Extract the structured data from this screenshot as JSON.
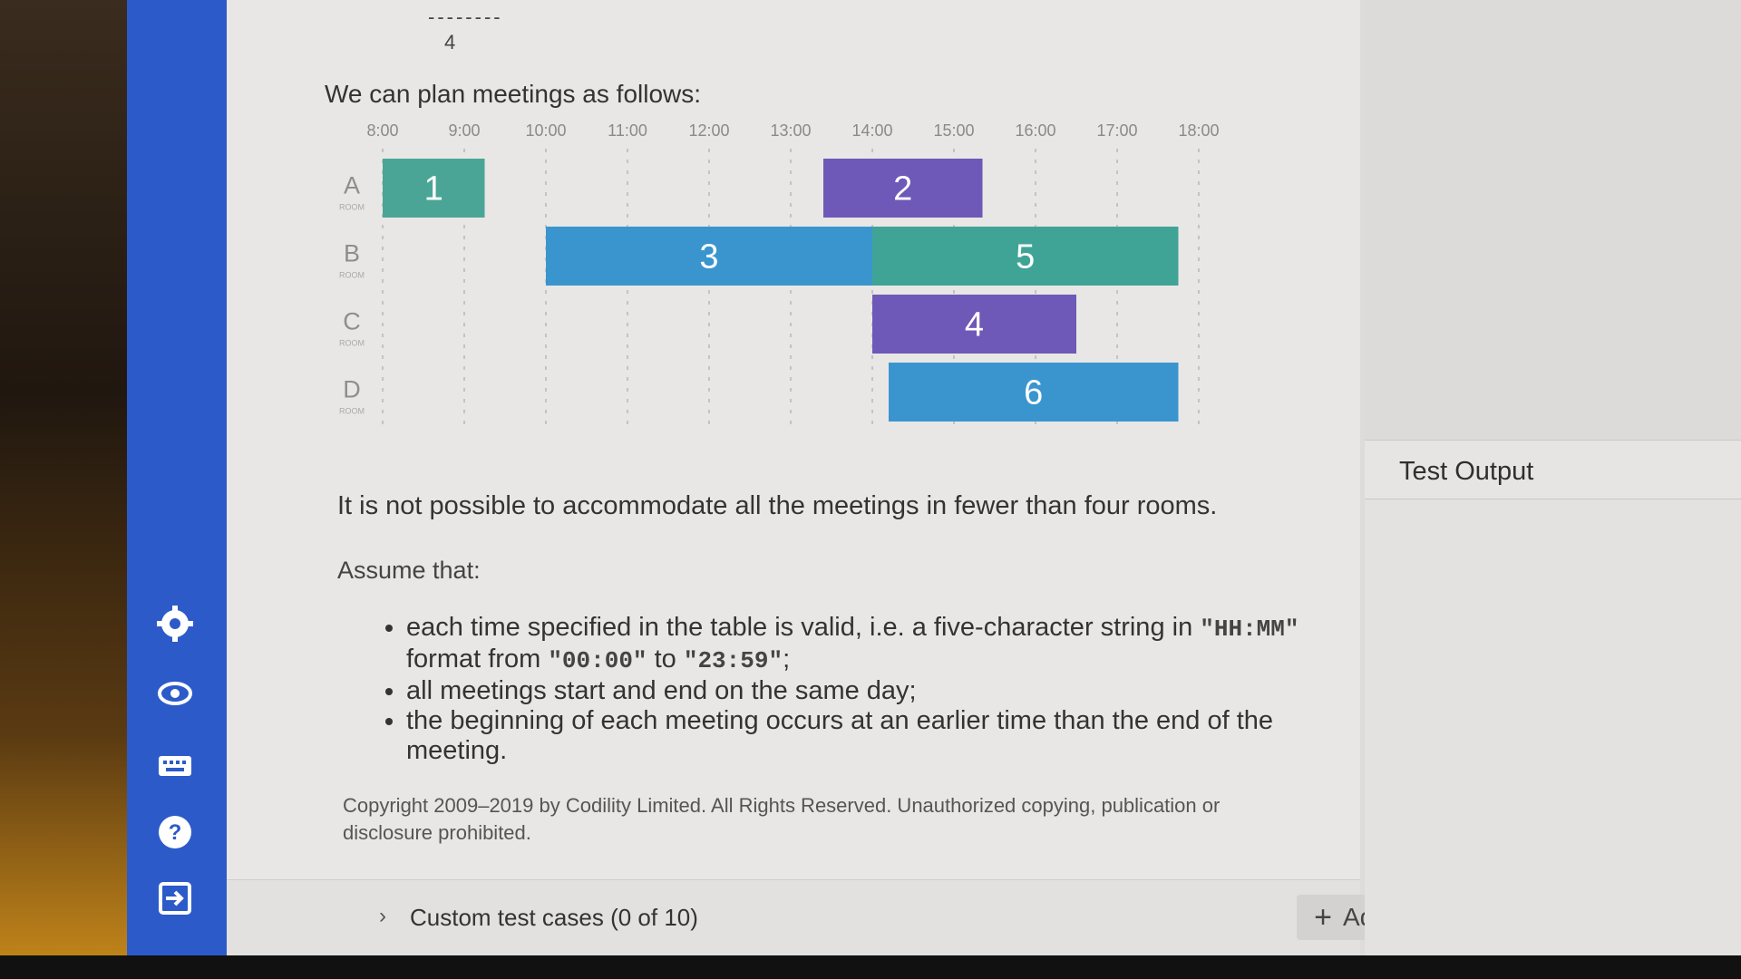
{
  "problem": {
    "previous_output_dashes": "--------",
    "previous_output_value": "4",
    "intro": "We can plan meetings as follows:",
    "conclusion": "It is not possible to accommodate all the meetings in fewer than four rooms.",
    "assume_heading": "Assume that:",
    "conditions": [
      {
        "before": "each time specified in the table is valid, i.e. a five-character string in ",
        "code1": "\"HH:MM\"",
        "mid1": " format from ",
        "code2": "\"00:00\"",
        "mid2": " to ",
        "code3": "\"23:59\"",
        "after": ";"
      },
      {
        "text": "all meetings start and end on the same day;"
      },
      {
        "text": "the beginning of each meeting occurs at an earlier time than the end of the meeting."
      }
    ],
    "copyright": "Copyright 2009–2019 by Codility Limited. All Rights Reserved. Unauthorized copying, publication or disclosure prohibited."
  },
  "chart_data": {
    "type": "timeline",
    "time_labels": [
      "8:00",
      "9:00",
      "10:00",
      "11:00",
      "12:00",
      "13:00",
      "14:00",
      "15:00",
      "16:00",
      "17:00",
      "18:00"
    ],
    "rooms": [
      {
        "name": "A",
        "sub": "ROOM"
      },
      {
        "name": "B",
        "sub": "ROOM"
      },
      {
        "name": "C",
        "sub": "ROOM"
      },
      {
        "name": "D",
        "sub": "ROOM"
      }
    ],
    "meetings": [
      {
        "label": "1",
        "room": 0,
        "start": 8.0,
        "end": 9.25,
        "color": "#4aa596"
      },
      {
        "label": "2",
        "room": 0,
        "start": 13.4,
        "end": 15.35,
        "color": "#6e58b8"
      },
      {
        "label": "3",
        "room": 1,
        "start": 10.0,
        "end": 14.0,
        "color": "#3a95cf"
      },
      {
        "label": "5",
        "room": 1,
        "start": 14.0,
        "end": 17.75,
        "color": "#3fa496"
      },
      {
        "label": "4",
        "room": 2,
        "start": 14.0,
        "end": 16.5,
        "color": "#6e58b8"
      },
      {
        "label": "6",
        "room": 3,
        "start": 14.2,
        "end": 17.75,
        "color": "#3a95cf"
      }
    ]
  },
  "sidebar": {
    "accent": "#2c5bc9",
    "icons": [
      {
        "name": "settings-icon"
      },
      {
        "name": "eye-icon"
      },
      {
        "name": "keyboard-icon"
      },
      {
        "name": "help-icon"
      },
      {
        "name": "exit-icon"
      }
    ]
  },
  "custom_tests": {
    "label": "Custom test cases (0 of 10)",
    "chevron": "›",
    "add_plus": "+",
    "add_label": "Add"
  },
  "test_output": {
    "title": "Test Output"
  }
}
